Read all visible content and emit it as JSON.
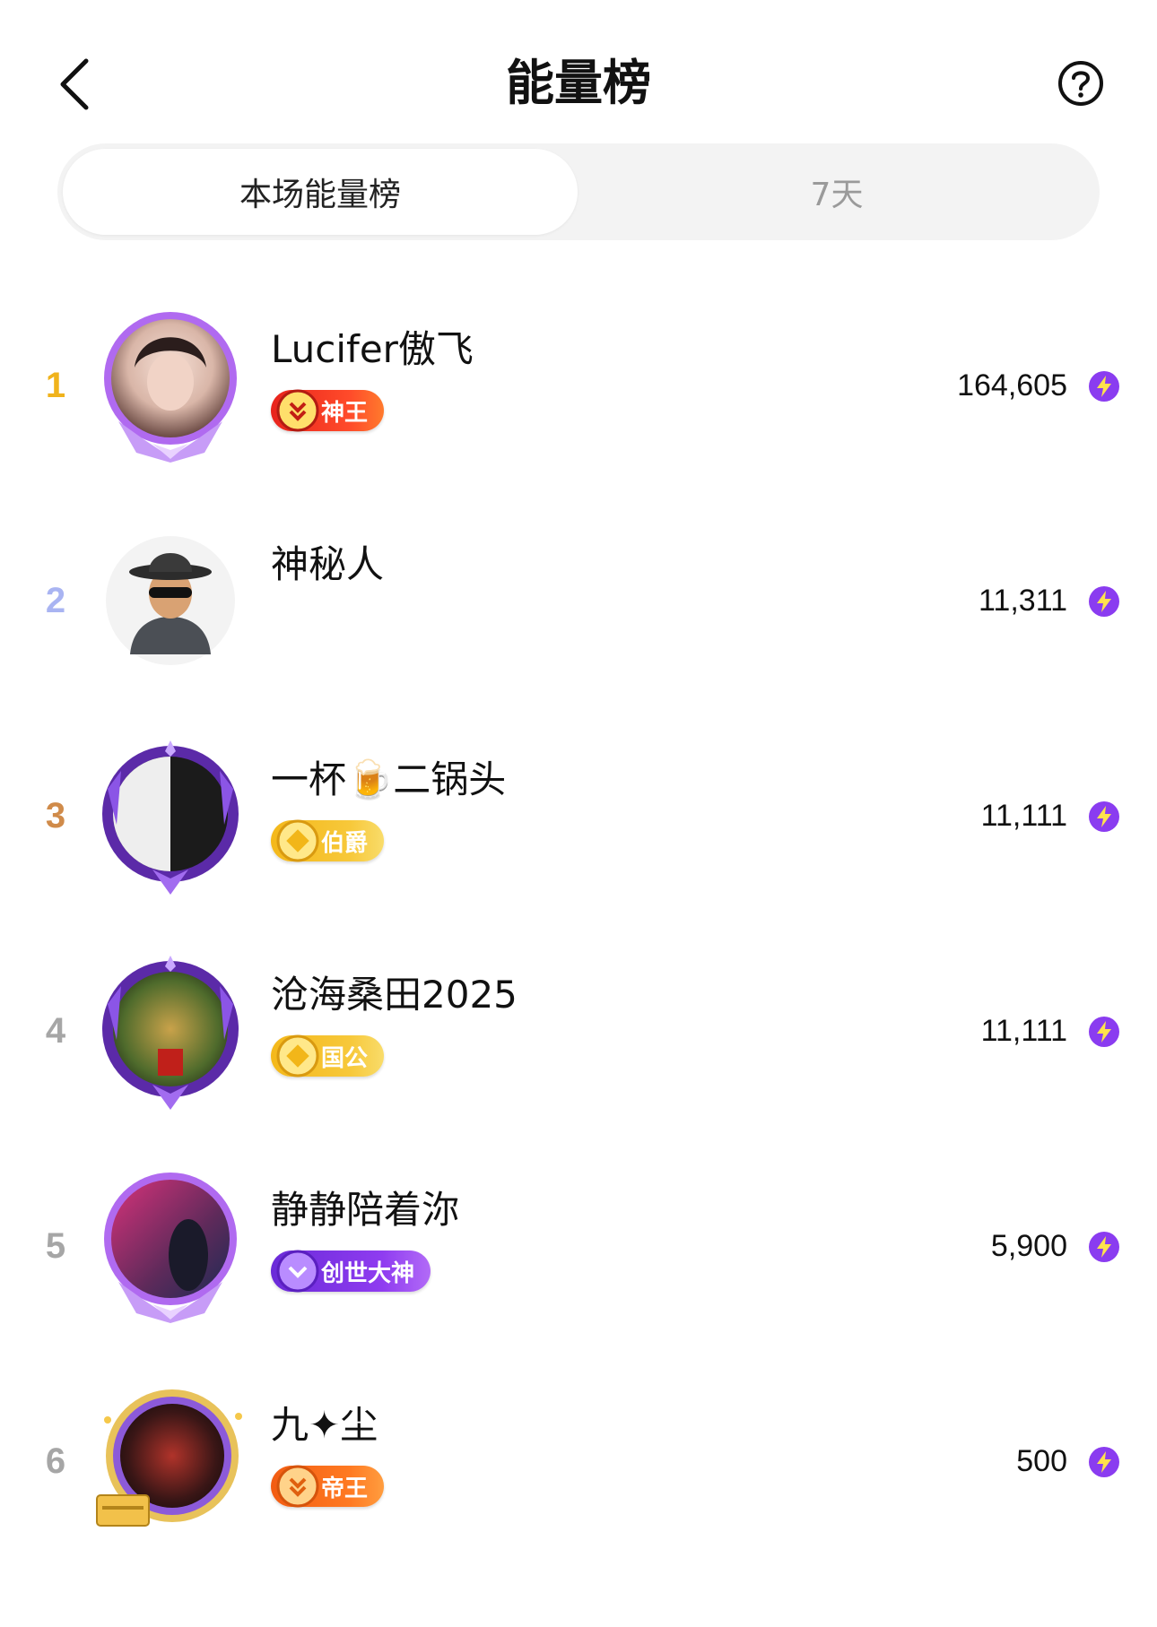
{
  "header": {
    "title": "能量榜",
    "back_icon": "chevron-left-icon",
    "help_icon": "question-circle-icon"
  },
  "tabs": [
    {
      "label": "本场能量榜",
      "active": true
    },
    {
      "label": "7天",
      "active": false
    }
  ],
  "ranking": [
    {
      "rank": "1",
      "rank_color": "#f0b31c",
      "name": "Lucifer傲飞",
      "badge": "神王",
      "badge_style": "red",
      "score": "164,605",
      "avatar_frame": "purple-wings"
    },
    {
      "rank": "2",
      "rank_color": "#a9b4f2",
      "name": "神秘人",
      "badge": "",
      "badge_style": "",
      "score": "11,311",
      "avatar_frame": "none"
    },
    {
      "rank": "3",
      "rank_color": "#d08b4a",
      "name": "一杯🍺二锅头",
      "badge": "伯爵",
      "badge_style": "gold",
      "score": "11,111",
      "avatar_frame": "purple-crest"
    },
    {
      "rank": "4",
      "rank_color": "#a6a6a6",
      "name": "沧海桑田2025",
      "badge": "国公",
      "badge_style": "gold",
      "score": "11,111",
      "avatar_frame": "purple-crest"
    },
    {
      "rank": "5",
      "rank_color": "#a6a6a6",
      "name": "静静陪着沵",
      "badge": "创世大神",
      "badge_style": "purple",
      "score": "5,900",
      "avatar_frame": "purple-wings"
    },
    {
      "rank": "6",
      "rank_color": "#a6a6a6",
      "name": "九✦尘",
      "badge": "帝王",
      "badge_style": "orange",
      "score": "500",
      "avatar_frame": "gold-card"
    }
  ],
  "score_icon": "lightning-energy-icon",
  "colors": {
    "accent_purple": "#7b3cf0",
    "segment_bg": "#f3f3f3",
    "inactive_tab_text": "#9a9a9a"
  }
}
